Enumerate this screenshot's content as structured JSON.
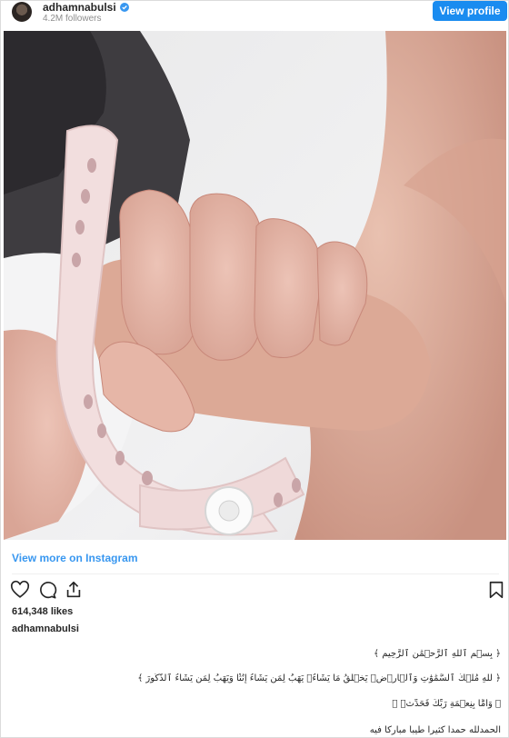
{
  "header": {
    "username": "adhamnabulsi",
    "followers": "4.2M followers",
    "view_profile_label": "View profile"
  },
  "post": {
    "view_more_label": "View more on Instagram",
    "likes": "614,348 likes",
    "caption_user": "adhamnabulsi",
    "caption_lines": [
      "﴿ بِسۡمِ ٱللَّهِ ٱلرَّحۡمَٰنِ ٱلرَّحِيمِ ﴾",
      "﴿ لِّلَّهِ مُلۡكُ ٱلسَّمَٰوَٰتِ وَٱلۡأَرۡضِۚ يَخۡلُقُ مَا يَشَآءُۚ يَهَبُ لِمَن يَشَآءُ إِنَٰثٗا وَيَهَبُ لِمَن يَشَآءُ ٱلذُّكُورَ ﴾",
      "﴿ وَأَمَّا بِنِعۡمَةِ رَبِّكَ فَحَدِّثۡ ﴾",
      "الحمدلله حمداً كثيراً طيباً مباركاً فيه"
    ]
  },
  "icons": {
    "avatar": "avatar",
    "verified": "verified-badge-icon",
    "like": "heart-icon",
    "comment": "comment-icon",
    "share": "share-icon",
    "save": "bookmark-icon"
  },
  "colors": {
    "accent": "#1a8cf0",
    "link": "#3897f0",
    "text": "#262626",
    "muted": "#8e8e8e"
  }
}
